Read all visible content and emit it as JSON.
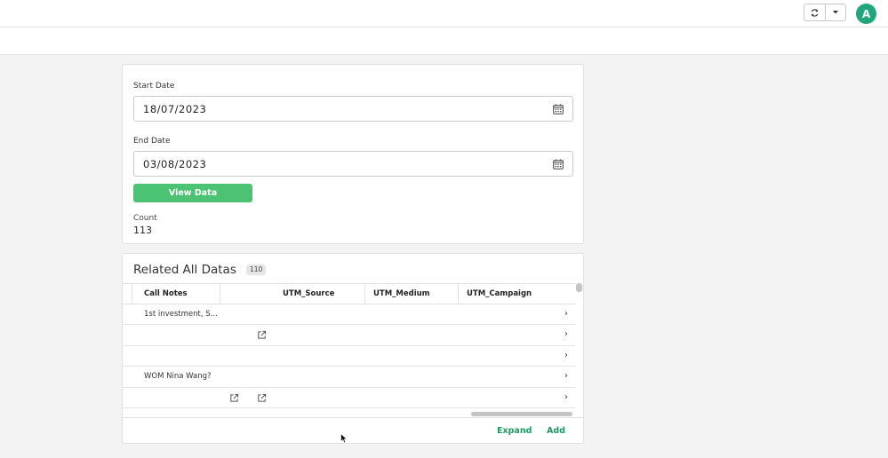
{
  "header": {
    "refresh_icon": "refresh-icon",
    "dropdown_icon": "caret-down-icon",
    "avatar_initial": "A",
    "avatar_color": "#1fa67a"
  },
  "filter": {
    "start_label": "Start Date",
    "start_value": "18/07/2023",
    "end_label": "End Date",
    "end_value": "03/08/2023",
    "calendar_icon": "calendar-icon",
    "view_button": "View Data",
    "view_button_color": "#4cc273",
    "count_label": "Count",
    "count_value": "113"
  },
  "related": {
    "title": "Related All Datas",
    "badge": "110",
    "columns": [
      "Call Notes",
      "UTM_Source",
      "UTM_Medium",
      "UTM_Campaign"
    ],
    "rows": [
      {
        "call_notes": "1st investment, S..."
      },
      {
        "call_notes": ""
      },
      {
        "call_notes": ""
      },
      {
        "call_notes": "WOM Nina Wang?"
      },
      {
        "call_notes": ""
      }
    ],
    "expand_label": "Expand",
    "add_label": "Add",
    "link_color": "#1b9b61"
  }
}
